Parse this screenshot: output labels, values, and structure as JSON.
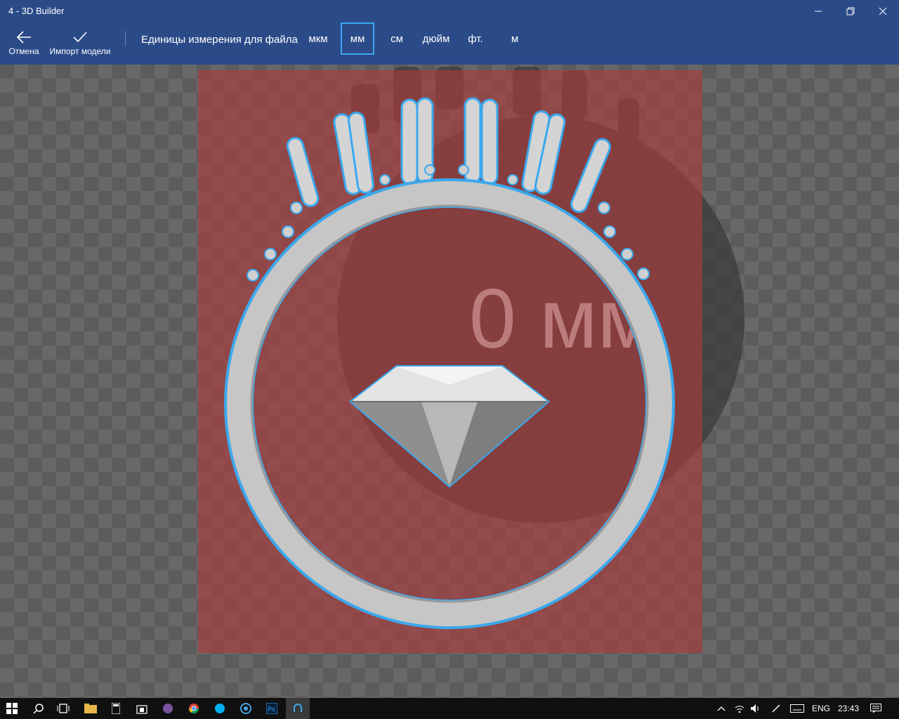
{
  "window": {
    "title": "4 - 3D Builder"
  },
  "toolbar": {
    "cancel_label": "Отмена",
    "import_label": "Импорт модели",
    "units_label": "Единицы измерения для файла",
    "units": [
      {
        "label": "мкм",
        "selected": false
      },
      {
        "label": "мм",
        "selected": true
      },
      {
        "label": "см",
        "selected": false
      },
      {
        "label": "дюйм",
        "selected": false
      },
      {
        "label": "фт.",
        "selected": false
      },
      {
        "label": "м",
        "selected": false
      }
    ]
  },
  "viewport": {
    "dimension_text": "0 мм",
    "colors": {
      "selection_outline": "#3aa8ee",
      "model_fill": "#c4c4c4",
      "bed_overlay": "#b03a3a"
    }
  },
  "taskbar": {
    "apps": [
      "start-icon",
      "search-icon",
      "task-view-icon",
      "file-explorer-icon",
      "calculator-icon",
      "store-icon",
      "viber-icon",
      "chrome-icon",
      "skype-icon",
      "app-icon",
      "photoshop-icon",
      "3d-builder-icon"
    ],
    "language": "ENG",
    "time": "23:43"
  }
}
